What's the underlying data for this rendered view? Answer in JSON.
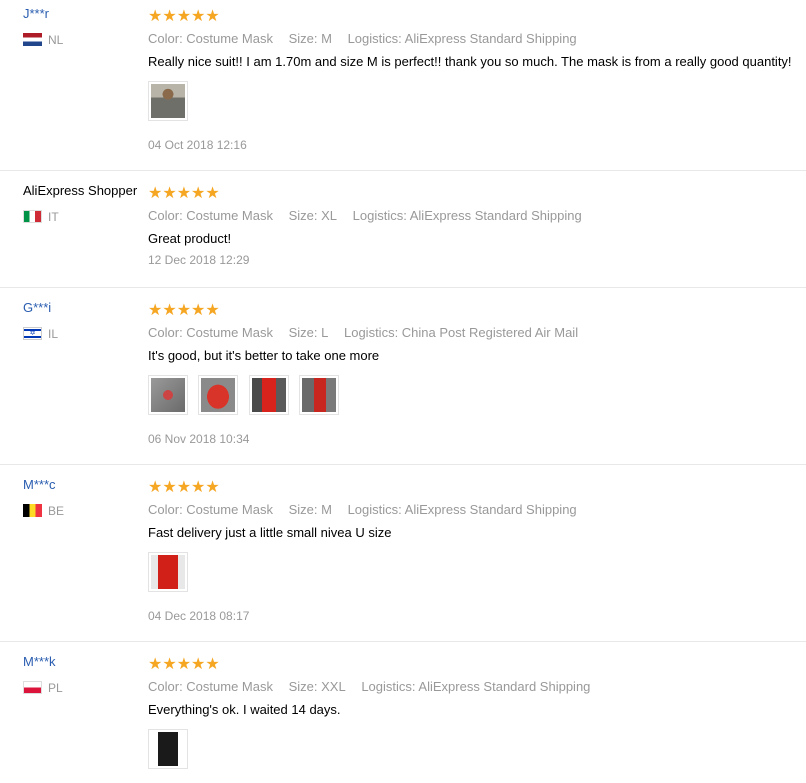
{
  "reviews": [
    {
      "user": "J***r",
      "country": "NL",
      "stars": "★★★★★",
      "color": "Color: Costume Mask",
      "size": "Size: M",
      "logistics": "Logistics: AliExpress Standard Shipping",
      "text": "Really nice suit!! I am 1.70m and size M is perfect!! thank you so much. The mask is from a really good quantity!",
      "date": "04 Oct 2018 12:16"
    },
    {
      "user": "AliExpress Shopper",
      "country": "IT",
      "stars": "★★★★★",
      "color": "Color: Costume Mask",
      "size": "Size: XL",
      "logistics": "Logistics: AliExpress Standard Shipping",
      "text": "Great product!",
      "date": "12 Dec 2018 12:29"
    },
    {
      "user": "G***i",
      "country": "IL",
      "stars": "★★★★★",
      "color": "Color: Costume Mask",
      "size": "Size: L",
      "logistics": "Logistics: China Post Registered Air Mail",
      "text": "It's good, but it's better to take one more",
      "date": "06 Nov 2018 10:34"
    },
    {
      "user": "M***c",
      "country": "BE",
      "stars": "★★★★★",
      "color": "Color: Costume Mask",
      "size": "Size: M",
      "logistics": "Logistics: AliExpress Standard Shipping",
      "text": "Fast delivery just a little small nivea U size",
      "date": "04 Dec 2018 08:17"
    },
    {
      "user": "M***k",
      "country": "PL",
      "stars": "★★★★★",
      "color": "Color: Costume Mask",
      "size": "Size: XXL",
      "logistics": "Logistics: AliExpress Standard Shipping",
      "text": "Everything's ok. I waited 14 days.",
      "date": ""
    }
  ],
  "colors": {
    "star": "#f5a623",
    "link": "#2a5db0",
    "muted": "#999999",
    "divider": "#e8e8e8"
  }
}
